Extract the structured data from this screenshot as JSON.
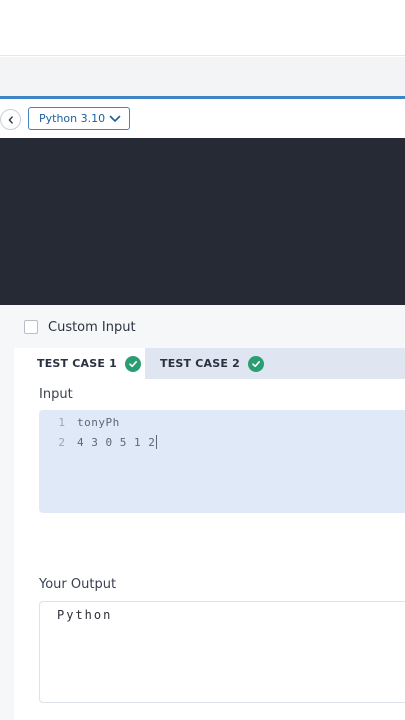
{
  "toolbar": {
    "back_icon": "chevron-left-icon",
    "language": "Python 3.10",
    "dropdown_icon": "chevron-down-icon"
  },
  "custom_input": {
    "label": "Custom Input",
    "checked": false
  },
  "tabs": [
    {
      "label": "TEST CASE 1",
      "status": "passed",
      "active": true
    },
    {
      "label": "TEST CASE 2",
      "status": "passed",
      "active": false
    }
  ],
  "input": {
    "title": "Input",
    "lines": [
      {
        "number": "1",
        "text": "tonyPh"
      },
      {
        "number": "2",
        "text": "4 3 0 5 1 2"
      }
    ]
  },
  "output": {
    "title": "Your Output",
    "text": "Python"
  },
  "colors": {
    "accent": "#3f84c4",
    "editor_bg": "#262a35",
    "success": "#2a9d72",
    "input_bg": "#dfe9f7"
  }
}
